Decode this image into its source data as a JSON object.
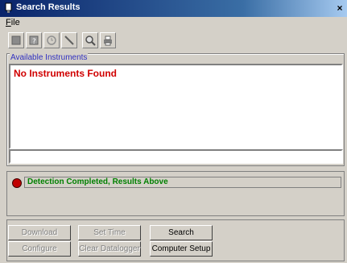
{
  "window": {
    "title": "Search Results",
    "close_label": "×"
  },
  "menu": {
    "file": "File"
  },
  "toolbar": {
    "buttons": [
      {
        "icon": "stop-icon"
      },
      {
        "icon": "help-icon"
      },
      {
        "icon": "clock-icon"
      },
      {
        "icon": "probe-icon"
      },
      {
        "icon": "magnifier-icon"
      },
      {
        "icon": "printer-icon"
      }
    ]
  },
  "instruments": {
    "group_label": "Available Instruments",
    "empty_message": "No Instruments Found",
    "input_value": ""
  },
  "status": {
    "message": "Detection Completed, Results Above",
    "indicator_color": "#c00000",
    "text_color": "#008000"
  },
  "buttons": {
    "download": "Download",
    "set_time": "Set Time",
    "search": "Search",
    "configure": "Configure",
    "clear_datalogger": "Clear Datalogger",
    "computer_setup": "Computer Setup"
  }
}
